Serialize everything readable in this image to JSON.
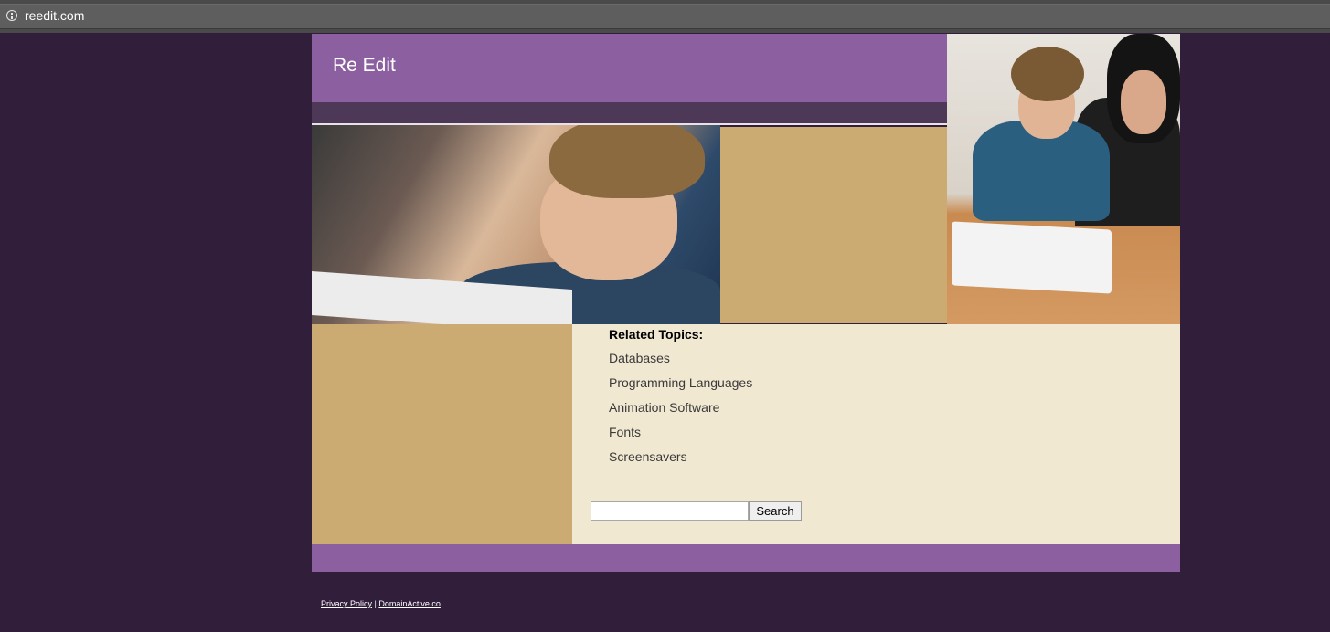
{
  "browser": {
    "url": "reedit.com",
    "info_icon": "info-circle-icon"
  },
  "header": {
    "site_title": "Re Edit"
  },
  "colors": {
    "page_background": "#311e3b",
    "header_purple": "#8b5fa0",
    "subbar_dark_purple": "#4e3858",
    "tan": "#cbab71",
    "content_cream": "#f1e8d2"
  },
  "related": {
    "title": "Related Topics:",
    "topics": [
      {
        "label": "Databases"
      },
      {
        "label": "Programming Languages"
      },
      {
        "label": "Animation Software"
      },
      {
        "label": "Fonts"
      },
      {
        "label": "Screensavers"
      }
    ]
  },
  "search": {
    "value": "",
    "placeholder": "",
    "button_label": "Search"
  },
  "footer": {
    "privacy_label": "Privacy Policy",
    "separator": "|",
    "domain_label": "DomainActive.co"
  }
}
